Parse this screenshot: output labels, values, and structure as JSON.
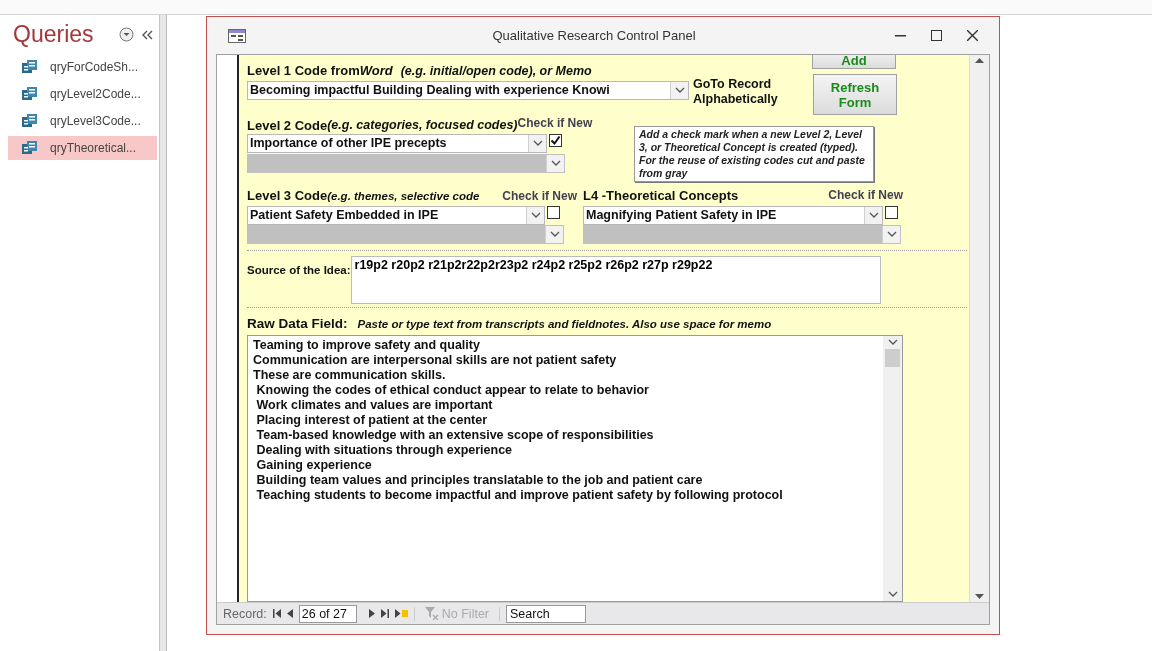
{
  "navigation_pane": {
    "title": "Queries",
    "items": [
      {
        "label": "qryForCodeSh...",
        "selected": false
      },
      {
        "label": "qryLevel2Code...",
        "selected": false
      },
      {
        "label": "qryLevel3Code...",
        "selected": false
      },
      {
        "label": "qryTheoretical...",
        "selected": true
      }
    ]
  },
  "form_window": {
    "title": "Qualitative Research Control Panel",
    "add_button": "Add",
    "refresh_button": "Refresh Form",
    "level1": {
      "label": "Level 1 Code from",
      "label_word": "Word",
      "hint": "(e.g. initial/open code), or Memo",
      "value": "Becoming impactful Building Dealing with experience Knowi",
      "goto_label": "GoTo Record Alphabetically"
    },
    "level2": {
      "label": "Level 2 Code",
      "hint": "(e.g. categories, focused codes)",
      "check_label": "Check if New",
      "value": "Importance of other IPE precepts",
      "checked": true
    },
    "note": "Add a check mark when a new Level 2, Level 3, or Theoretical Concept is created (typed).  For the reuse of existing codes cut and paste from gray",
    "level3": {
      "label": "Level 3 Code",
      "hint": "(e.g. themes, selective code",
      "check_label": "Check if New",
      "value": "Patient Safety Embedded in IPE",
      "checked": false
    },
    "level4": {
      "label": "L4 -Theoretical Concepts",
      "check_label": "Check if New",
      "value": "Magnifying Patient Safety in IPE",
      "checked": false
    },
    "source": {
      "label": "Source of the Idea:",
      "value": "r19p2 r20p2 r21p2r22p2r23p2 r24p2 r25p2 r26p2 r27p r29p22"
    },
    "raw_data": {
      "label": "Raw Data  Field:",
      "hint": "Paste or type text from transcripts and fieldnotes. Also use space for memo",
      "lines": [
        "Teaming to improve safety and quality",
        "Communication are interpersonal skills are not patient safety",
        "These are communication skills.",
        " Knowing the codes of ethical conduct appear to relate to behavior",
        " Work climates and values are important",
        " Placing interest of patient at the center",
        " Team-based knowledge with an extensive scope of responsibilities",
        " Dealing with situations through experience",
        " Gaining experience",
        " Building team values and principles translatable to the job and patient care",
        " Teaching students to become impactful and improve patient safety by following protocol"
      ]
    },
    "record_bar": {
      "label": "Record:",
      "position": "26 of 27",
      "filter": "No Filter",
      "filter_disabled": true,
      "search_placeholder": "Search"
    }
  }
}
